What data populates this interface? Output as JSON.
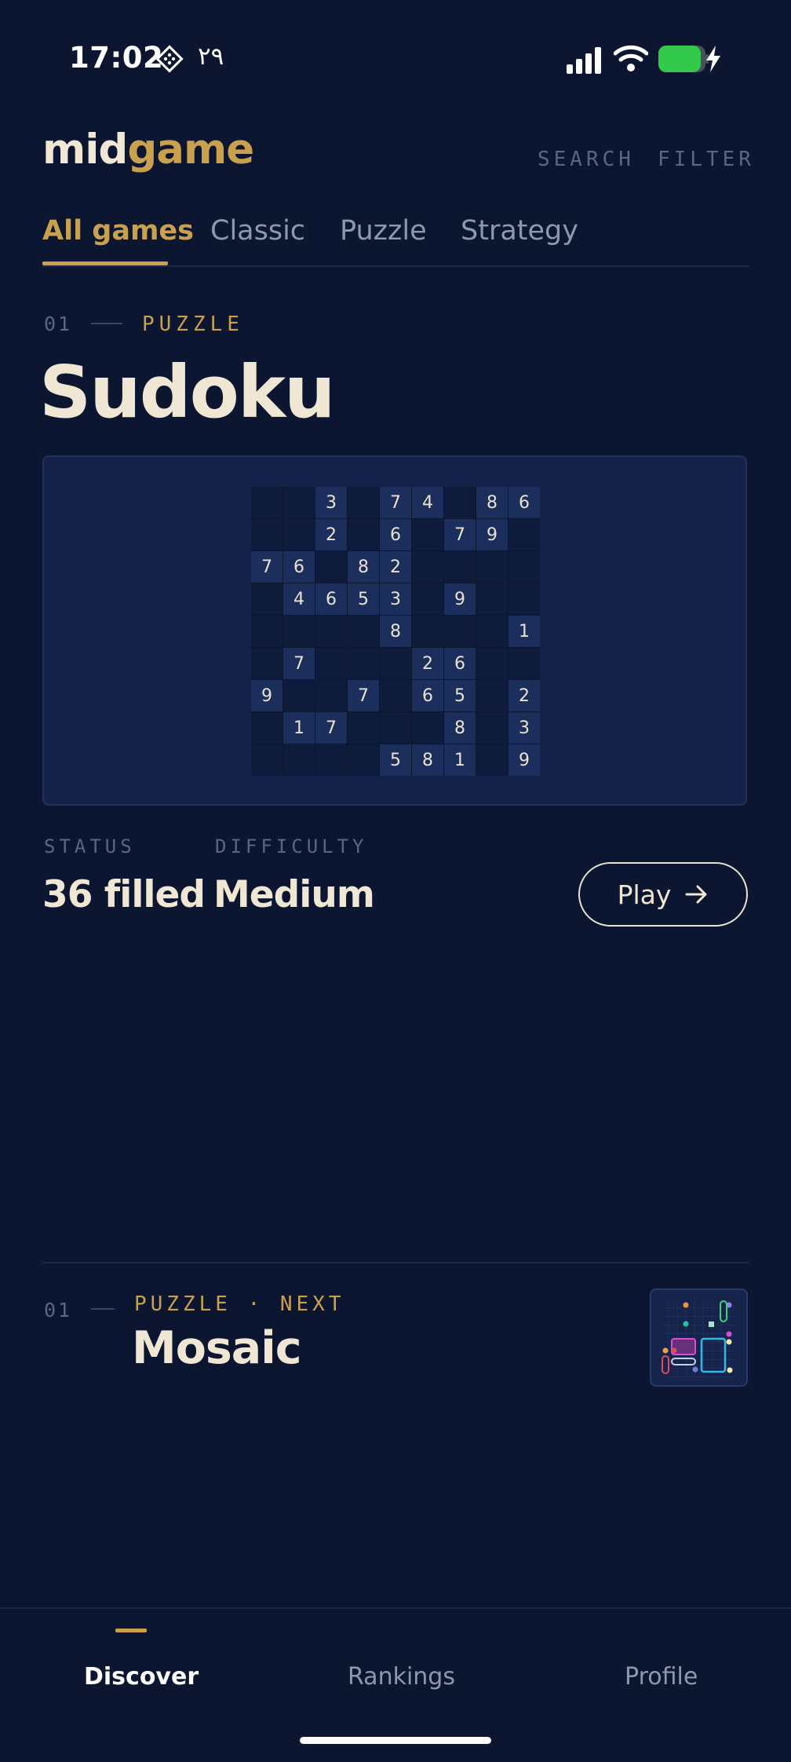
{
  "status_bar": {
    "time": "17:02",
    "extra": "۲۹",
    "icons": [
      "badge-icon",
      "signal-icon",
      "wifi-icon",
      "battery-icon",
      "charging-icon"
    ]
  },
  "header": {
    "logo_part1": "mid",
    "logo_part2": "game",
    "search_label": "SEARCH",
    "filter_label": "FILTER"
  },
  "tabs": [
    {
      "label": "All games",
      "active": true
    },
    {
      "label": "Classic",
      "active": false
    },
    {
      "label": "Puzzle",
      "active": false
    },
    {
      "label": "Strategy",
      "active": false
    }
  ],
  "featured": {
    "index": "01",
    "category": "PUZZLE",
    "title": "Sudoku",
    "status_label": "STATUS",
    "status_value": "36 filled",
    "difficulty_label": "DIFFICULTY",
    "difficulty_value": "Medium",
    "play_label": "Play",
    "grid": [
      [
        0,
        0,
        3,
        0,
        7,
        4,
        0,
        8,
        6
      ],
      [
        0,
        0,
        2,
        0,
        6,
        0,
        7,
        9,
        0
      ],
      [
        7,
        6,
        0,
        8,
        2,
        0,
        0,
        0,
        0
      ],
      [
        0,
        4,
        6,
        5,
        3,
        0,
        9,
        0,
        0
      ],
      [
        0,
        0,
        0,
        0,
        8,
        0,
        0,
        0,
        1
      ],
      [
        0,
        7,
        0,
        0,
        0,
        2,
        6,
        0,
        0
      ],
      [
        9,
        0,
        0,
        7,
        0,
        6,
        5,
        0,
        2
      ],
      [
        0,
        1,
        7,
        0,
        0,
        0,
        8,
        0,
        3
      ],
      [
        0,
        0,
        0,
        0,
        5,
        8,
        1,
        0,
        9
      ]
    ]
  },
  "next": {
    "index": "01",
    "category": "PUZZLE · NEXT",
    "title": "Mosaic"
  },
  "bottom_nav": [
    {
      "label": "Discover",
      "active": true
    },
    {
      "label": "Rankings",
      "active": false
    },
    {
      "label": "Profile",
      "active": false
    }
  ],
  "colors": {
    "background": "#0c1630",
    "accent": "#c9a14e",
    "text": "#efe6d3",
    "muted": "#5b6682"
  }
}
